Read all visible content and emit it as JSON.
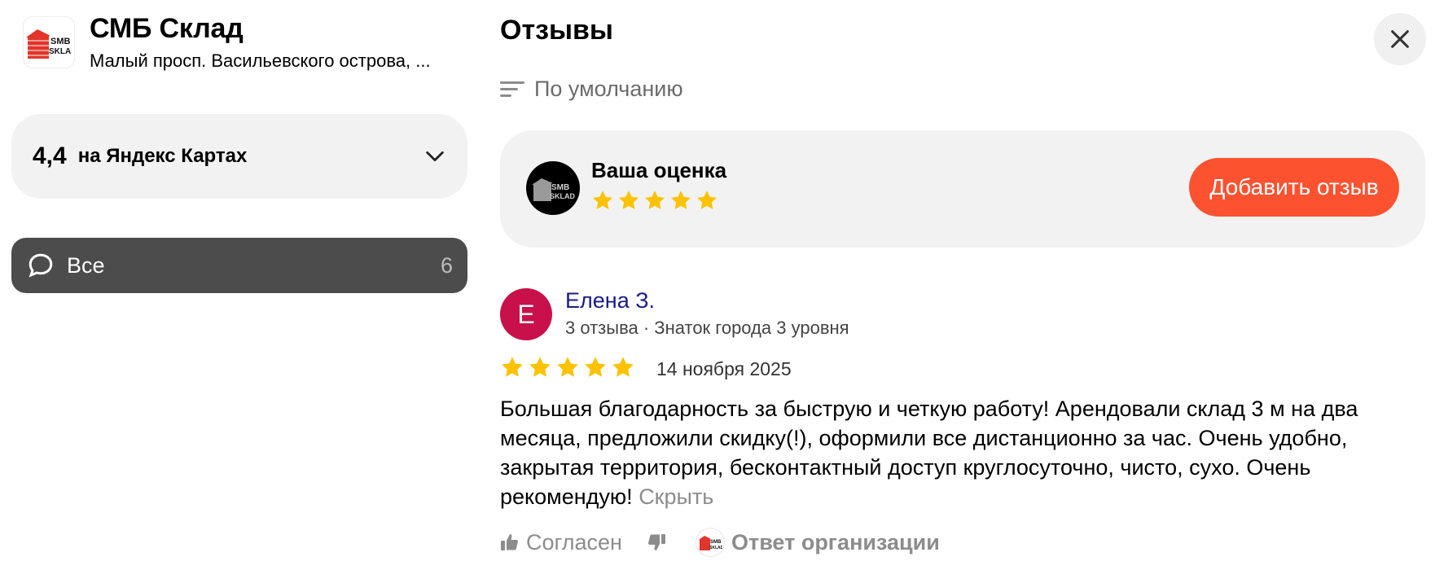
{
  "org": {
    "logo_text_1": "SMB",
    "logo_text_2": "SKLAD",
    "title": "СМБ Склад",
    "address": "Малый просп. Васильевского острова, ..."
  },
  "rating_card": {
    "value": "4,4",
    "where": "на Яндекс Картах",
    "icon": "chevron-down-icon"
  },
  "filter": {
    "label": "Все",
    "count": "6",
    "icon": "speech-bubble-icon"
  },
  "reviews": {
    "title": "Отзывы",
    "sort_label": "По умолчанию",
    "close_icon": "close-icon"
  },
  "your_rating": {
    "label": "Ваша оценка",
    "stars_total": 5,
    "add_button": "Добавить отзыв"
  },
  "review": {
    "avatar_letter": "Е",
    "author": "Елена З.",
    "meta": "3 отзыва · Знаток города 3 уровня",
    "rating": 5,
    "date": "14 ноября 2025",
    "text": "Большая благодарность за быструю и четкую работу! Арендовали склад 3 м на два месяца, предложили скидку(!), оформили все дистанционно за час. Очень удобно, закрытая территория, бесконтактный доступ круглосуточно, чисто, сухо. Очень рекомендую!",
    "hide_label": "Скрыть",
    "agree_label": "Согласен",
    "org_reply_label": "Ответ организации"
  },
  "colors": {
    "accent": "#fc5230",
    "star": "#fcc200",
    "author_avatar": "#c8104a",
    "filter_bg": "#4c4c4c",
    "author_link": "#1a1a8c"
  }
}
